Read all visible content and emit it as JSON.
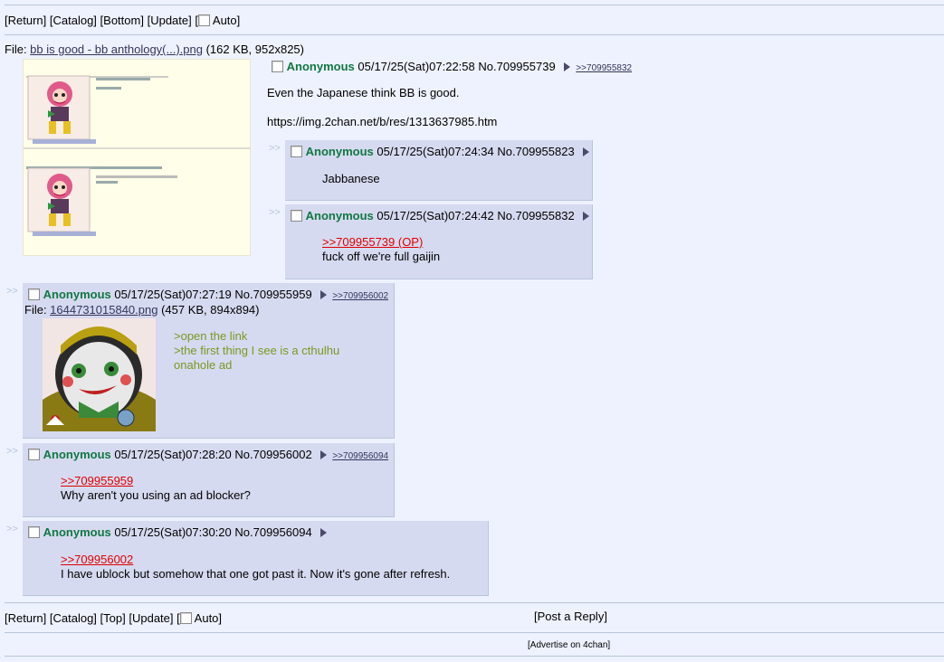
{
  "top_nav": {
    "return": "[Return]",
    "catalog": "[Catalog]",
    "bottom": "[Bottom]",
    "update": "[Update]",
    "auto_open": "[",
    "auto": "Auto]"
  },
  "op": {
    "file_prefix": "File: ",
    "file_name": "bb is good - bb anthology(...).png",
    "file_meta": " (162 KB, 952x825)",
    "name": "Anonymous",
    "datetime": "05/17/25(Sat)07:22:58",
    "number": "No.709955739",
    "backlink": ">>709955832",
    "lines": [
      "Even the Japanese think BB is good.",
      "",
      "https://img.2chan.net/b/res/1313637985.htm"
    ]
  },
  "replies": [
    {
      "name": "Anonymous",
      "datetime": "05/17/25(Sat)07:24:34",
      "number": "No.709955823",
      "body": "Jabbanese"
    },
    {
      "name": "Anonymous",
      "datetime": "05/17/25(Sat)07:24:42",
      "number": "No.709955832",
      "quote": ">>709955739 (OP)",
      "body": "fuck off we're full gaijin"
    },
    {
      "name": "Anonymous",
      "datetime": "05/17/25(Sat)07:27:19",
      "number": "No.709955959",
      "backlink": ">>709956002",
      "file_prefix": "File: ",
      "file_name": "1644731015840.png",
      "file_meta": " (457 KB, 894x894)",
      "greentext": [
        ">open the link",
        ">the first thing I see is a cthulhu",
        "onahole ad"
      ]
    },
    {
      "name": "Anonymous",
      "datetime": "05/17/25(Sat)07:28:20",
      "number": "No.709956002",
      "backlink": ">>709956094",
      "quote": ">>709955959",
      "body": "Why aren't you using an ad blocker?"
    },
    {
      "name": "Anonymous",
      "datetime": "05/17/25(Sat)07:30:20",
      "number": "No.709956094",
      "quote": ">>709956002",
      "body": "I have ublock but somehow that one got past it. Now it's gone after refresh."
    }
  ],
  "side_arrows": ">>",
  "bottom_nav": {
    "return": "[Return]",
    "catalog": "[Catalog]",
    "top": "[Top]",
    "update": "[Update]",
    "auto_open": "[",
    "auto": "Auto]",
    "post_reply": "[Post a Reply]",
    "advertise": "[Advertise on 4chan]"
  },
  "colors": {
    "background": "#eef2ff",
    "reply_bg": "#d6daf0",
    "name": "#117743",
    "quote": "#dd0000",
    "greentext": "#789922"
  }
}
